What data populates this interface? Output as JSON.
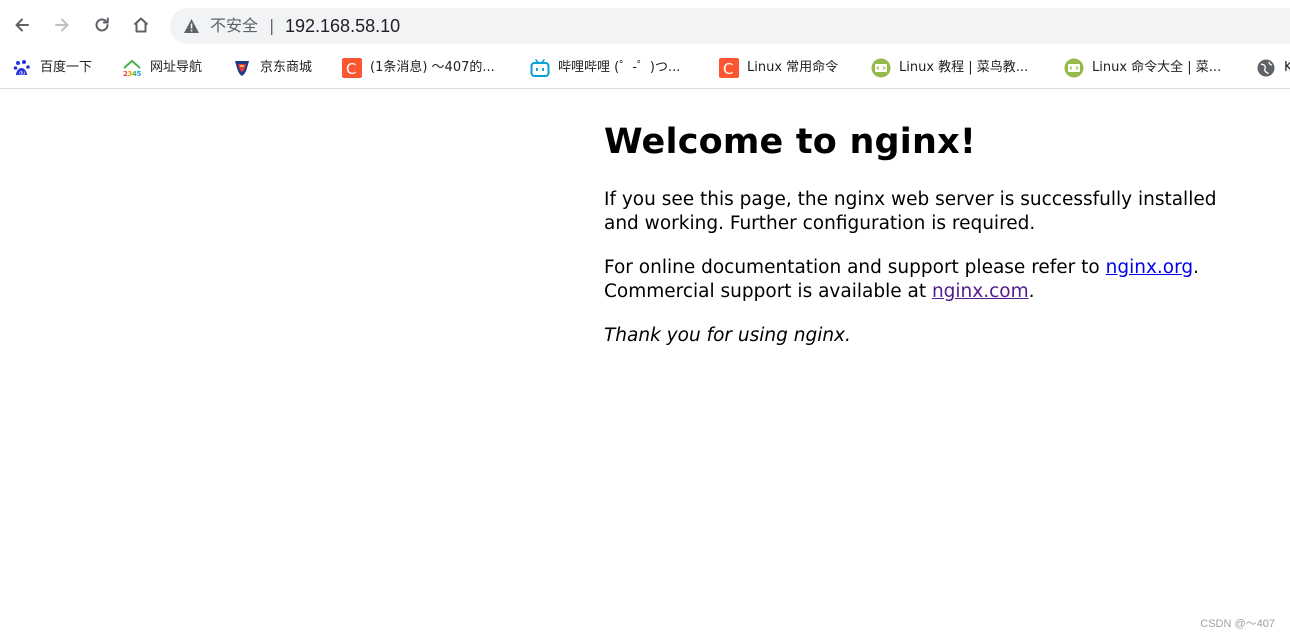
{
  "browser": {
    "security_label": "不安全",
    "separator": "|",
    "url": "192.168.58.10",
    "icons": {
      "back": "back-arrow-icon",
      "forward": "forward-arrow-icon",
      "reload": "reload-icon",
      "home": "home-icon",
      "warning": "warning-triangle-icon"
    }
  },
  "bookmarks": [
    {
      "label": "百度一下",
      "icon": "baidu-icon",
      "color": "#2932e1"
    },
    {
      "label": "网址导航",
      "icon": "2345-icon",
      "color": "#4caf50"
    },
    {
      "label": "京东商城",
      "icon": "jd-icon",
      "color": "#e4393c"
    },
    {
      "label": "(1条消息) ～407的...",
      "icon": "csdn-icon",
      "color": "#fc5531"
    },
    {
      "label": "哔哩哔哩 (゜-゜)つ...",
      "icon": "bilibili-icon",
      "color": "#00a1d6"
    },
    {
      "label": "Linux 常用命令",
      "icon": "csdn-icon",
      "color": "#fc5531"
    },
    {
      "label": "Linux 教程 | 菜鸟教...",
      "icon": "runoob-icon",
      "color": "#96b94a"
    },
    {
      "label": "Linux 命令大全 | 菜...",
      "icon": "runoob-icon",
      "color": "#96b94a"
    },
    {
      "label": "K",
      "icon": "globe-icon",
      "color": "#5f6368"
    }
  ],
  "page": {
    "heading": "Welcome to nginx!",
    "para1": "If you see this page, the nginx web server is successfully installed and working. Further configuration is required.",
    "para2_prefix": "For online documentation and support please refer to ",
    "link1": "nginx.org",
    "para2_mid": ".",
    "para3_prefix": "Commercial support is available at ",
    "link2": "nginx.com",
    "para3_suffix": ".",
    "thanks": "Thank you for using nginx."
  },
  "watermark": "CSDN @～407"
}
